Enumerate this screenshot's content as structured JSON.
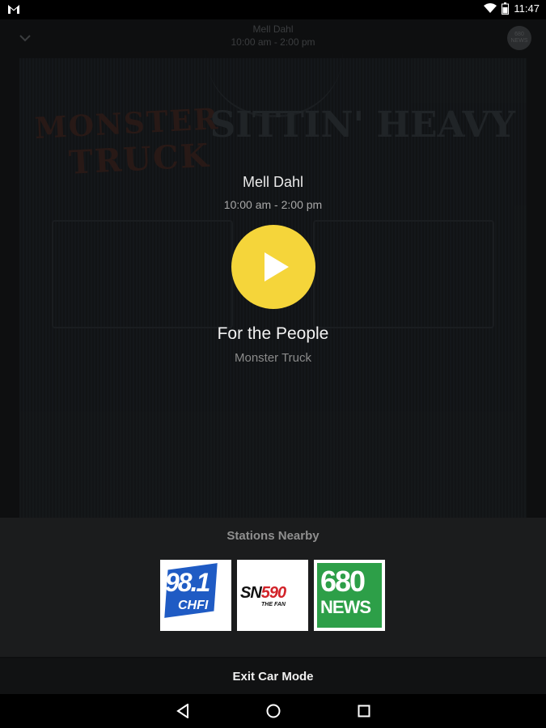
{
  "status_bar": {
    "time": "11:47"
  },
  "header": {
    "host": "Mell Dahl",
    "schedule": "10:00 am - 2:00 pm",
    "station_logo_text": "680 NEWS"
  },
  "artwork": {
    "left_logo": "MONSTER",
    "left_logo_sub": "TRUCK",
    "right_logo": "SITTIN' HEAVY"
  },
  "now_playing": {
    "show_name": "Mell Dahl",
    "show_time": "10:00 am - 2:00 pm",
    "song_title": "For the People",
    "artist": "Monster Truck"
  },
  "stations": {
    "title": "Stations Nearby",
    "items": [
      {
        "frequency": "98.1",
        "call": "CHFI",
        "brand_color": "#1f5bc4"
      },
      {
        "name_prefix": "SN",
        "frequency": "590",
        "sub": "THE FAN",
        "brand_color": "#d2232a"
      },
      {
        "frequency": "680",
        "word": "NEWS",
        "brand_color": "#2d9f48"
      }
    ]
  },
  "exit": {
    "label": "Exit Car Mode"
  },
  "colors": {
    "accent": "#f5d53a",
    "panel": "#1b1c1d"
  }
}
